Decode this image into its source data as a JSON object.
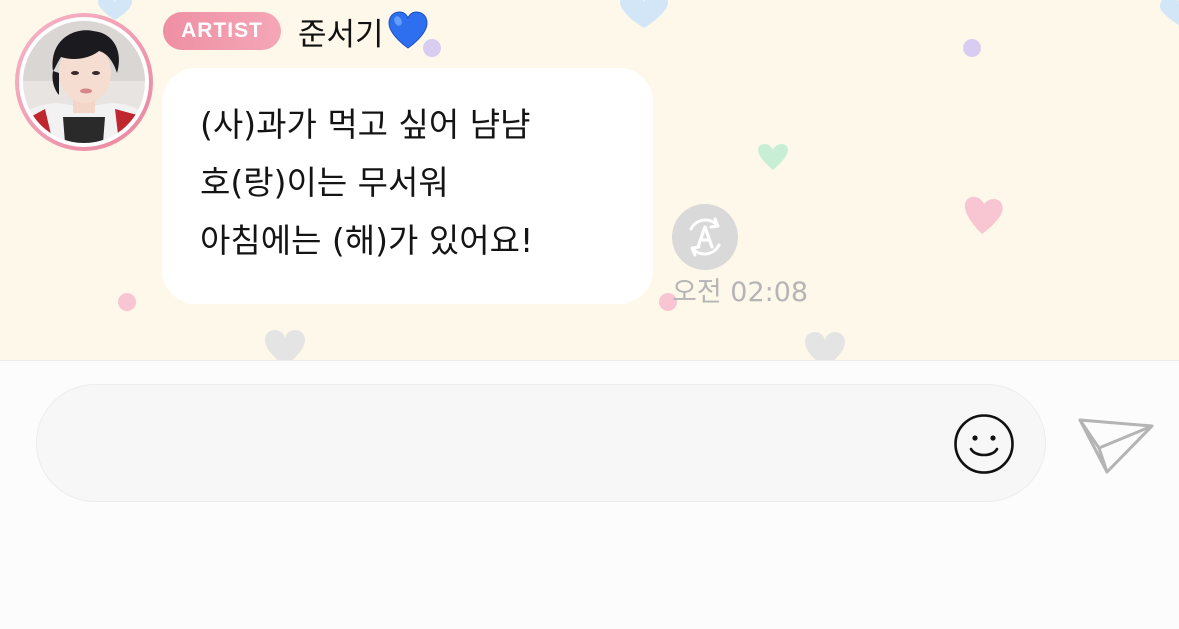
{
  "chat": {
    "sender": {
      "badge": "ARTIST",
      "name": "준서기",
      "name_emoji": "blue-heart"
    },
    "message": {
      "lines": [
        "(사)과가 먹고 싶어 냠냠",
        "호(랑)이는 무서워",
        "아침에는 (해)가 있어요!"
      ],
      "time": "오전 02:08"
    },
    "translate_icon": "translate-a-icon"
  },
  "composer": {
    "placeholder": "",
    "emoji_icon": "smiley-icon",
    "send_icon": "paper-plane-icon"
  },
  "colors": {
    "chat_background": "#fef8ea",
    "badge": "#ef8fa4",
    "bubble": "#ffffff",
    "timestamp": "#b5b5b5",
    "input_background": "#f7f7f7"
  }
}
